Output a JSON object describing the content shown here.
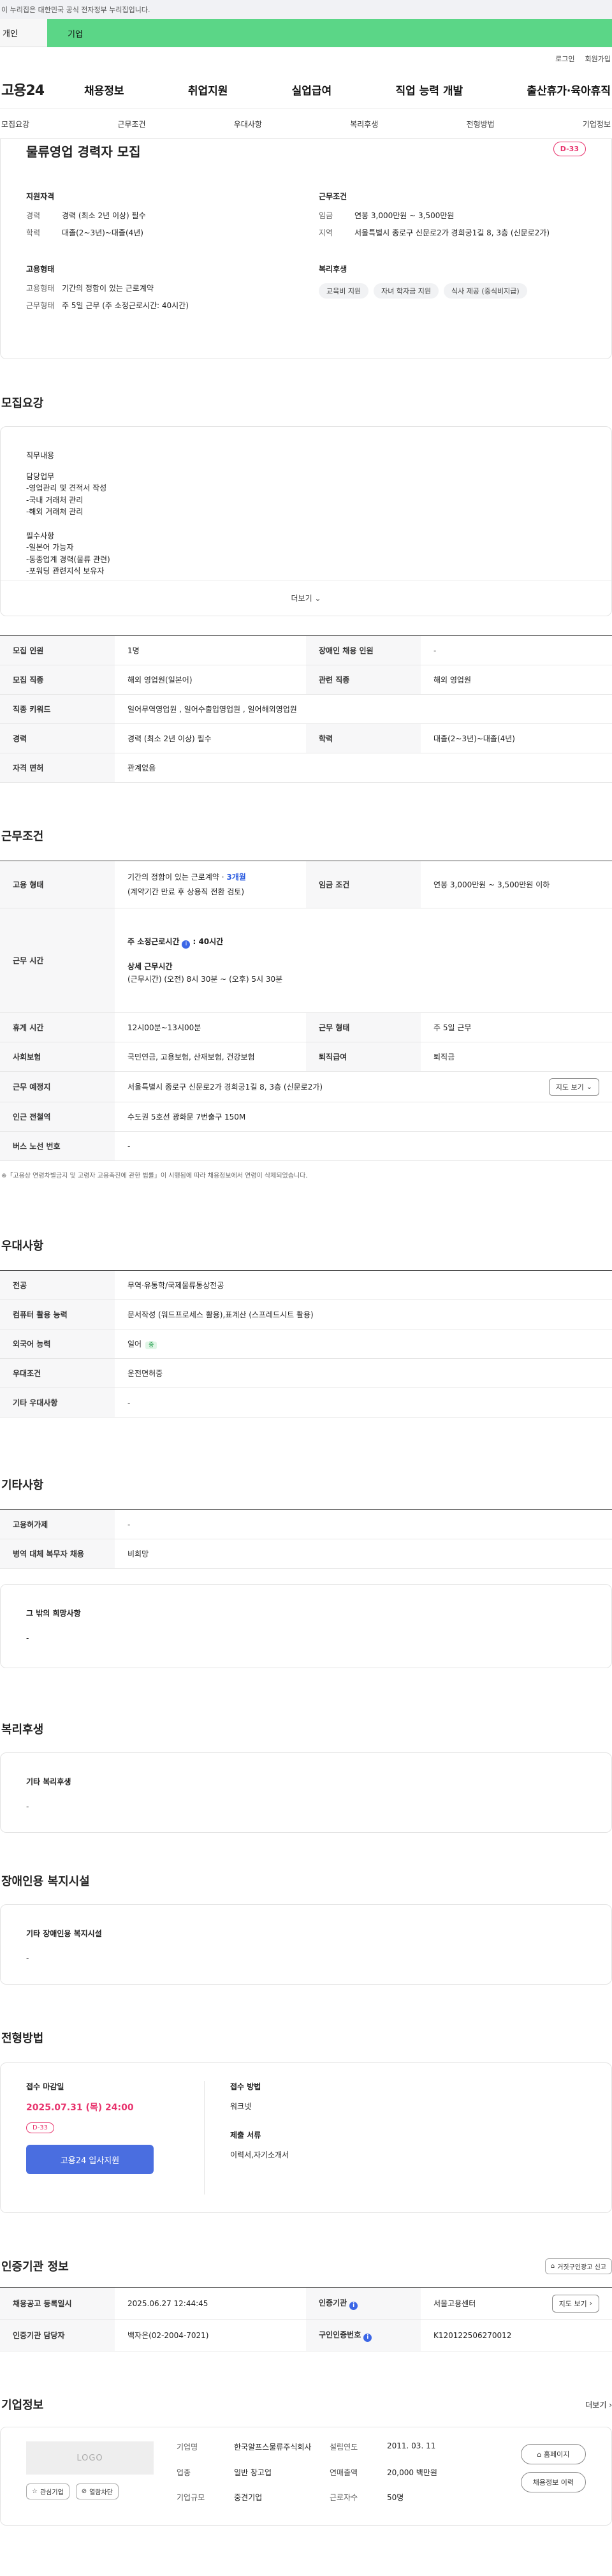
{
  "gov_banner": "이 누리집은 대한민국 공식 전자정부 누리집입니다.",
  "user_tabs": {
    "personal": "개인",
    "corporate": "기업"
  },
  "util_links": [
    "로그인",
    "회원가입"
  ],
  "gnb": {
    "logo": "고용24",
    "menu": [
      "채용정보",
      "취업지원",
      "실업급여",
      "직업 능력 개발",
      "출산휴가·육아휴직"
    ]
  },
  "tabs": [
    "모집요강",
    "근무조건",
    "우대사항",
    "복리후생",
    "전형방법",
    "기업정보"
  ],
  "summary": {
    "title": "물류영업 경력자 모집",
    "dday": "D-33",
    "qualification": {
      "heading": "지원자격",
      "rows": [
        {
          "k": "경력",
          "v": "경력 (최소 2년 이상) 필수"
        },
        {
          "k": "학력",
          "v": "대졸(2~3년)~대졸(4년)"
        }
      ]
    },
    "work_condition": {
      "heading": "근무조건",
      "rows": [
        {
          "k": "임금",
          "v": "연봉 3,000만원 ~ 3,500만원"
        },
        {
          "k": "지역",
          "v": "서울특별시 종로구 신문로2가 경희궁1길 8, 3층 (신문로2가)"
        }
      ]
    },
    "employment": {
      "heading": "고용형태",
      "rows": [
        {
          "k": "고용형태",
          "v": "기간의 정함이 있는 근로계약"
        },
        {
          "k": "근무형태",
          "v": "주 5일 근무 (주 소정근로시간: 40시간)"
        }
      ]
    },
    "welfare": {
      "heading": "복리후생",
      "chips": [
        "교육비 지원",
        "자녀 학자금 지원",
        "식사 제공 (중식비지급)"
      ]
    }
  },
  "recruit": {
    "title": "모집요강",
    "desc_heading": "직무내용",
    "desc_body": "담당업무\n-영업관리 및 견적서 작성\n-국내 거래처 관리\n-해외 거래처 관리\n\n필수사항\n-일본어 가능자\n-동종업계 경력(물류 관련)\n-포워딩 관련지식 보유자",
    "more": "더보기",
    "table": {
      "headcount_k": "모집 인원",
      "headcount_v": "1명",
      "disabled_k": "장애인 채용 인원",
      "disabled_v": "-",
      "job_k": "모집 직종",
      "job_v": "해외 영업원(일본어)",
      "related_k": "관련 직종",
      "related_v": "해외 영업원",
      "keyword_k": "직종 키워드",
      "keyword_v": "일어무역영업원 , 일어수출입영업원 , 일어해외영업원",
      "career_k": "경력",
      "career_v": "경력 (최소 2년 이상) 필수",
      "edu_k": "학력",
      "edu_v": "대졸(2~3년)~대졸(4년)",
      "license_k": "자격 면허",
      "license_v": "관계없음"
    }
  },
  "work": {
    "title": "근무조건",
    "emp_k": "고용 형태",
    "emp_v1": "기간의 정함이 있는 근로계약 · ",
    "emp_v1_link": "3개월",
    "emp_v2": "(계약기간 만료 후 상용직 전환 검토)",
    "wage_k": "임금 조건",
    "wage_v": "연봉 3,000만원 ~ 3,500만원 이하",
    "hours_k": "근무 시간",
    "hours_h1": "주 소정근로시간",
    "hours_h1_v": ": 40시간",
    "hours_h2": "상세 근무시간",
    "hours_v2": "(근무시간) (오전) 8시 30분 ~ (오후) 5시 30분",
    "rest_k": "휴게 시간",
    "rest_v": "12시00분~13시00분",
    "type_k": "근무 형태",
    "type_v": "주 5일 근무",
    "insurance_k": "사회보험",
    "insurance_v": "국민연금, 고용보험, 산재보험, 건강보험",
    "retire_k": "퇴직급여",
    "retire_v": "퇴직금",
    "place_k": "근무 예정지",
    "place_v": "서울특별시 종로구 신문로2가 경희궁1길 8, 3층 (신문로2가)",
    "map_btn": "지도 보기",
    "subway_k": "인근 전철역",
    "subway_v": "수도권 5호선 광화문 7번출구 150M",
    "bus_k": "버스 노선 번호",
    "bus_v": "-",
    "note": "※「고용상 연령차별금지 및 고령자 고용촉진에 관한 법률」이 시행됨에 따라 채용정보에서 연령이 삭제되었습니다."
  },
  "pref": {
    "title": "우대사항",
    "major_k": "전공",
    "major_v": "무역·유통학/국제물류통상전공",
    "computer_k": "컴퓨터 활용 능력",
    "computer_v": "문서작성 (워드프로세스 활용),표계산 (스프레드시트 활용)",
    "lang_k": "외국어 능력",
    "lang_v": "일어",
    "lang_badge": "중",
    "cond_k": "우대조건",
    "cond_v": "운전면허증",
    "etc_k": "기타 우대사항",
    "etc_v": "-"
  },
  "etc": {
    "title": "기타사항",
    "trans_k": "고용허가제",
    "trans_v": "-",
    "military_k": "병역 대체 복무자 채용",
    "military_v": "비희망",
    "other_t": "그 밖의 희망사항",
    "other_v": "-"
  },
  "benefit": {
    "title": "복리후생",
    "box_t": "기타 복리후생",
    "box_v": "-"
  },
  "disabled": {
    "title": "장애인용 복지시설",
    "box_t": "기타 장애인용 복지시설",
    "box_v": "-"
  },
  "apply": {
    "title": "전형방법",
    "deadline_h": "접수 마감일",
    "deadline_v": "2025.07.31 (목) 24:00",
    "dday": "D-33",
    "apply_btn": "고용24 입사지원",
    "method_h": "접수 방법",
    "method_v": "워크넷",
    "docs_h": "제출 서류",
    "docs_v": "이력서,자기소개서"
  },
  "cert": {
    "title": "인증기관 정보",
    "report_btn": "거짓구인광고 신고",
    "reg_k": "채용공고 등록일시",
    "reg_v": "2025.06.27 12:44:45",
    "agency_k": "인증기관",
    "agency_v": "서울고용센터",
    "map_btn": "지도 보기",
    "manager_k": "인증기관 담당자",
    "manager_v": "백자은(02-2004-7021)",
    "reqno_k": "구인인증번호",
    "reqno_v": "K120122506270012"
  },
  "company": {
    "title": "기업정보",
    "more": "더보기",
    "logo": "LOGO",
    "fav_btn": "관심기업",
    "block_btn": "열람차단",
    "name_k": "기업명",
    "name_v": "한국알프스물류주식회사",
    "industry_k": "업종",
    "industry_v": "일반 창고업",
    "size_k": "기업규모",
    "size_v": "중견기업",
    "est_k": "설립연도",
    "est_v": "2011. 03. 11",
    "sales_k": "연매출액",
    "sales_v": "20,000 백만원",
    "emp_k": "근로자수",
    "emp_v": "50명",
    "home_btn": "홈페이지",
    "jobs_btn": "채용정보 이력"
  }
}
